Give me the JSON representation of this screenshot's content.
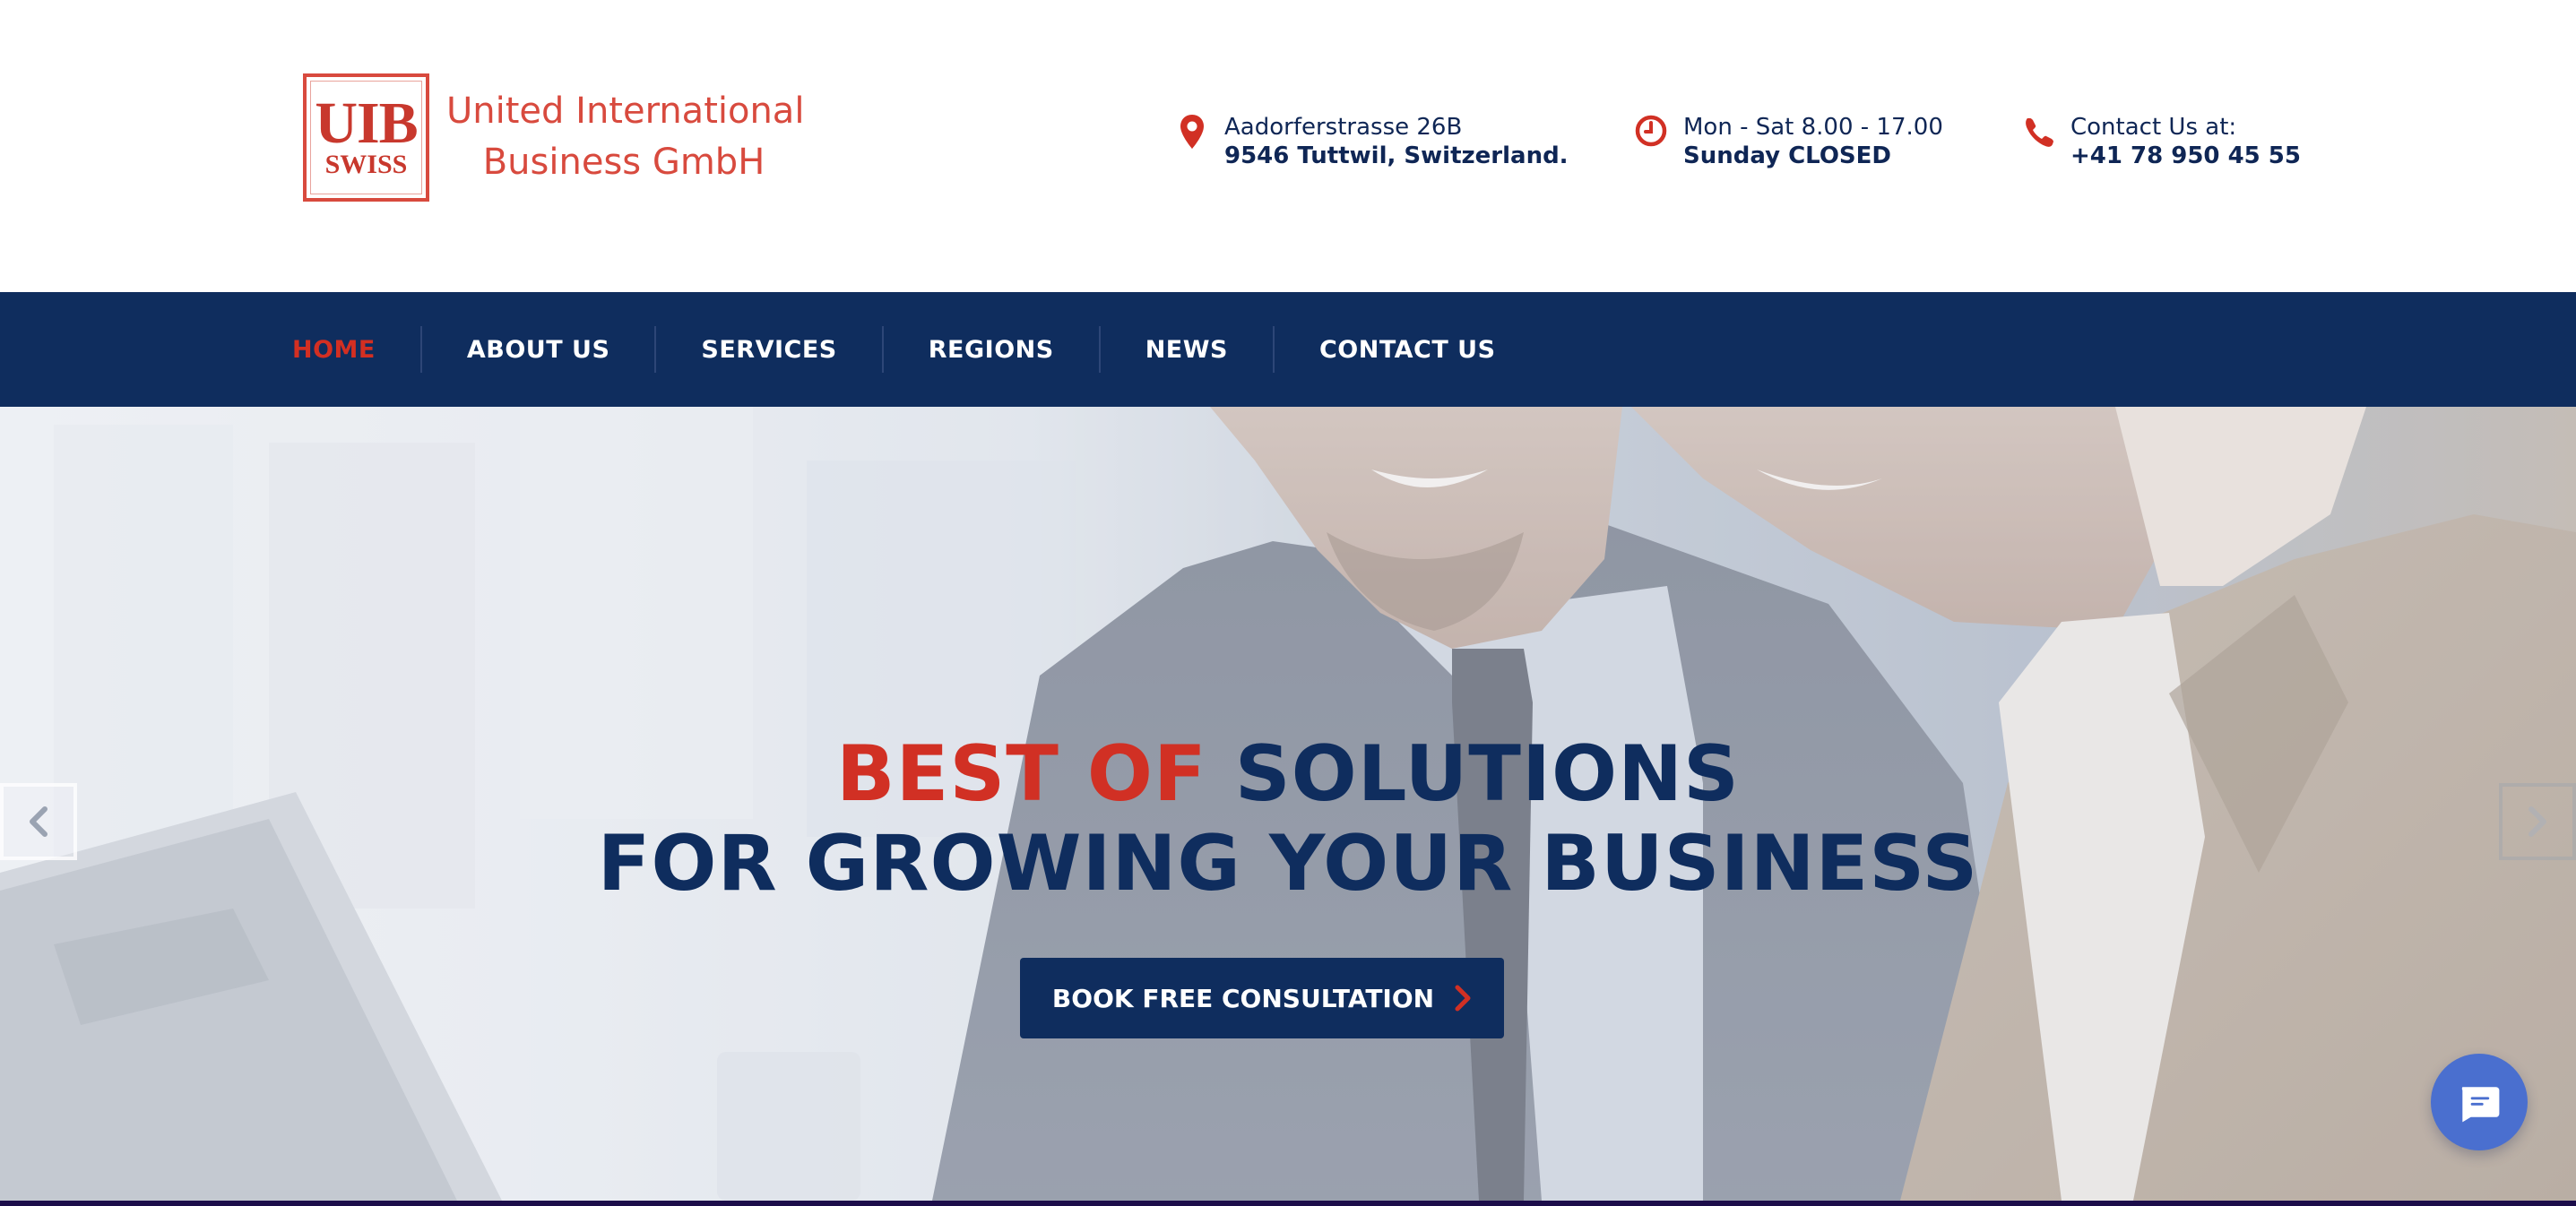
{
  "brand": {
    "logo_top": "UIB",
    "logo_bottom": "SWISS",
    "name_line1": "United International",
    "name_line2": "Business GmbH",
    "color": "#d84a3e"
  },
  "header_info": {
    "address": {
      "icon": "map-pin-icon",
      "line1": "Aadorferstrasse 26B",
      "line2": "9546 Tuttwil, Switzerland."
    },
    "hours": {
      "icon": "clock-icon",
      "line1": "Mon - Sat 8.00 - 17.00",
      "line2": "Sunday CLOSED"
    },
    "contact": {
      "icon": "phone-icon",
      "line1": "Contact Us at:",
      "line2": "+41 78 950 45 55"
    }
  },
  "nav": {
    "items": [
      {
        "label": "HOME",
        "active": true
      },
      {
        "label": "ABOUT US",
        "active": false
      },
      {
        "label": "SERVICES",
        "active": false
      },
      {
        "label": "REGIONS",
        "active": false
      },
      {
        "label": "NEWS",
        "active": false
      },
      {
        "label": "CONTACT US",
        "active": false
      }
    ]
  },
  "hero": {
    "headline_word1": "BEST",
    "headline_word2": "OF",
    "headline_word3": "SOLUTIONS",
    "headline_line2": "FOR GROWING YOUR BUSINESS",
    "cta_label": "BOOK FREE CONSULTATION"
  },
  "colors": {
    "navy": "#0f2d5e",
    "accent_red": "#d13024",
    "chat_blue": "#4a6fcf"
  }
}
